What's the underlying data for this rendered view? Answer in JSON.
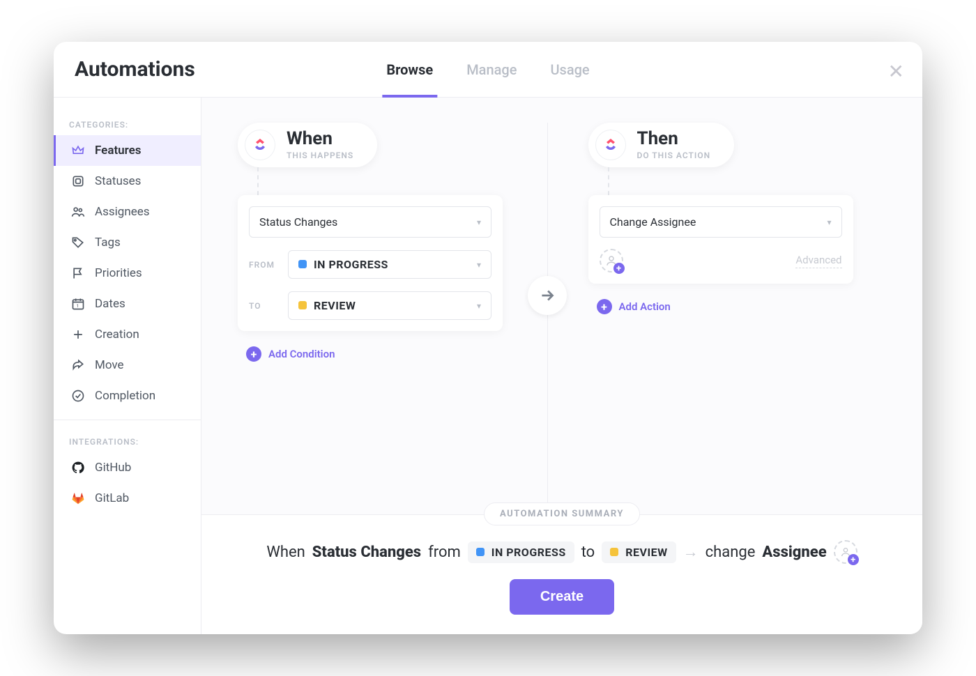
{
  "header": {
    "title": "Automations",
    "tabs": [
      {
        "label": "Browse",
        "active": true
      },
      {
        "label": "Manage",
        "active": false
      },
      {
        "label": "Usage",
        "active": false
      }
    ]
  },
  "sidebar": {
    "categories_heading": "CATEGORIES:",
    "categories": [
      {
        "label": "Features",
        "icon": "crown-icon",
        "active": true
      },
      {
        "label": "Statuses",
        "icon": "square-icon",
        "active": false
      },
      {
        "label": "Assignees",
        "icon": "people-icon",
        "active": false
      },
      {
        "label": "Tags",
        "icon": "tag-icon",
        "active": false
      },
      {
        "label": "Priorities",
        "icon": "flag-icon",
        "active": false
      },
      {
        "label": "Dates",
        "icon": "calendar-icon",
        "active": false
      },
      {
        "label": "Creation",
        "icon": "plus-icon",
        "active": false
      },
      {
        "label": "Move",
        "icon": "share-icon",
        "active": false
      },
      {
        "label": "Completion",
        "icon": "check-circle-icon",
        "active": false
      }
    ],
    "integrations_heading": "INTEGRATIONS:",
    "integrations": [
      {
        "label": "GitHub",
        "icon": "github-icon"
      },
      {
        "label": "GitLab",
        "icon": "gitlab-icon"
      }
    ]
  },
  "builder": {
    "when": {
      "title": "When",
      "subtitle": "THIS HAPPENS",
      "trigger_label": "Status Changes",
      "from_label": "FROM",
      "from_status": {
        "name": "IN PROGRESS",
        "color": "#4194f6"
      },
      "to_label": "TO",
      "to_status": {
        "name": "REVIEW",
        "color": "#f5c33b"
      },
      "add_condition": "Add Condition"
    },
    "then": {
      "title": "Then",
      "subtitle": "DO THIS ACTION",
      "action_label": "Change Assignee",
      "advanced_label": "Advanced",
      "add_action": "Add Action"
    }
  },
  "summary": {
    "chip": "AUTOMATION SUMMARY",
    "text": {
      "when": "When",
      "trigger": "Status Changes",
      "from": "from",
      "from_status": "IN PROGRESS",
      "to": "to",
      "to_status": "REVIEW",
      "change": "change",
      "target": "Assignee"
    },
    "create_button": "Create"
  },
  "colors": {
    "accent": "#7b68ee",
    "status_in_progress": "#4194f6",
    "status_review": "#f5c33b"
  }
}
